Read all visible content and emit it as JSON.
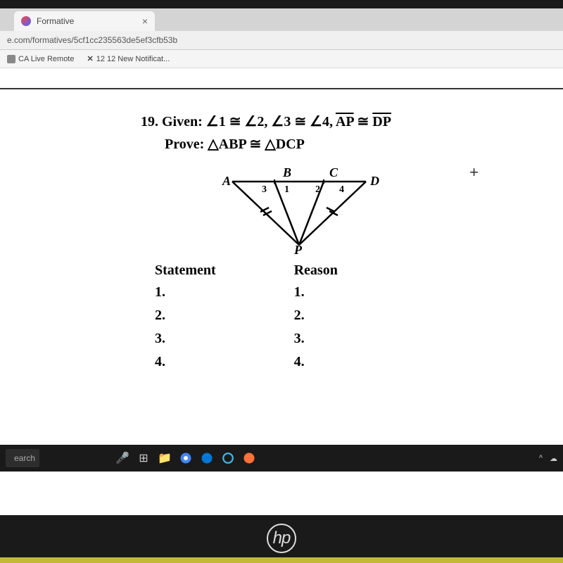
{
  "browser": {
    "tab": {
      "title": "Formative",
      "close": "×"
    },
    "url": "e.com/formatives/5cf1cc235563de5ef3cfb53b",
    "bookmarks": [
      {
        "label": "CA Live Remote"
      },
      {
        "label": "12 12 New Notificat..."
      }
    ]
  },
  "problem": {
    "number": "19.",
    "given_label": "Given:",
    "given_text": "∠1 ≅ ∠2, ∠3 ≅ ∠4, ",
    "given_seg1": "AP",
    "congruent": " ≅ ",
    "given_seg2": "DP",
    "prove_label": "Prove:",
    "prove_text": "△ABP ≅ △DCP"
  },
  "diagram": {
    "labels": {
      "A": "A",
      "B": "B",
      "C": "C",
      "D": "D",
      "P": "P",
      "a1": "1",
      "a2": "2",
      "a3": "3",
      "a4": "4"
    }
  },
  "table": {
    "col1_header": "Statement",
    "col2_header": "Reason",
    "rows": [
      "1.",
      "2.",
      "3.",
      "4."
    ]
  },
  "taskbar": {
    "search": "earch"
  },
  "cursor_plus": "+",
  "hp": "hp"
}
